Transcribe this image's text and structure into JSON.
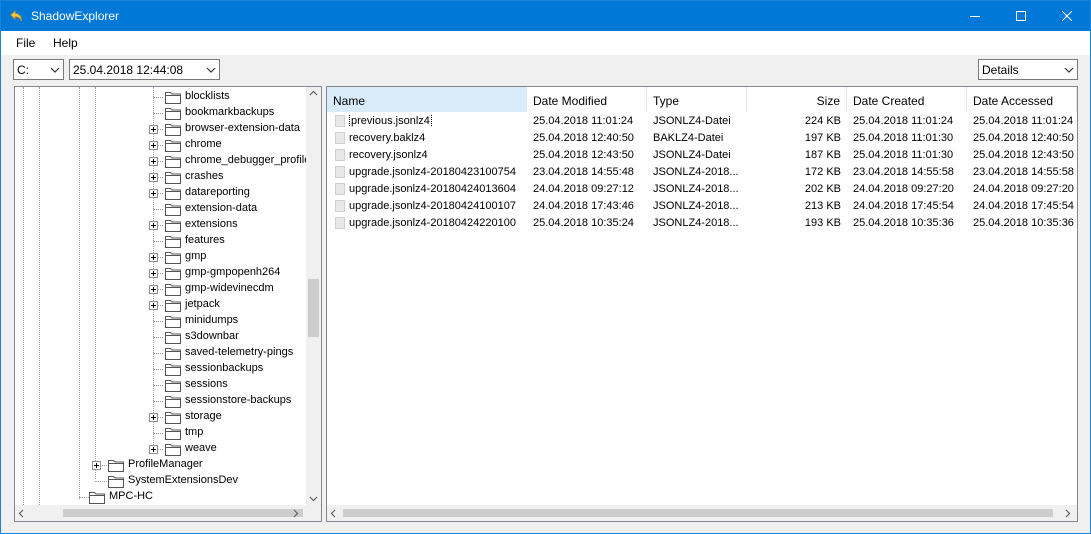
{
  "app": {
    "title": "ShadowExplorer"
  },
  "menu": {
    "file": "File",
    "help": "Help"
  },
  "toolbar": {
    "drive": "C:",
    "snapshot": "25.04.2018 12:44:08",
    "view": "Details"
  },
  "tree": {
    "items": [
      {
        "label": "blocklists",
        "expandable": false
      },
      {
        "label": "bookmarkbackups",
        "expandable": false
      },
      {
        "label": "browser-extension-data",
        "expandable": true
      },
      {
        "label": "chrome",
        "expandable": true
      },
      {
        "label": "chrome_debugger_profile",
        "expandable": true
      },
      {
        "label": "crashes",
        "expandable": true
      },
      {
        "label": "datareporting",
        "expandable": true
      },
      {
        "label": "extension-data",
        "expandable": false
      },
      {
        "label": "extensions",
        "expandable": true
      },
      {
        "label": "features",
        "expandable": false
      },
      {
        "label": "gmp",
        "expandable": true
      },
      {
        "label": "gmp-gmpopenh264",
        "expandable": true
      },
      {
        "label": "gmp-widevinecdm",
        "expandable": true
      },
      {
        "label": "jetpack",
        "expandable": true
      },
      {
        "label": "minidumps",
        "expandable": false
      },
      {
        "label": "s3downbar",
        "expandable": false
      },
      {
        "label": "saved-telemetry-pings",
        "expandable": false
      },
      {
        "label": "sessionbackups",
        "expandable": false
      },
      {
        "label": "sessions",
        "expandable": false
      },
      {
        "label": "sessionstore-backups",
        "expandable": false
      },
      {
        "label": "storage",
        "expandable": true
      },
      {
        "label": "tmp",
        "expandable": false
      },
      {
        "label": "weave",
        "expandable": true
      }
    ],
    "parent_items": [
      {
        "label": "ProfileManager",
        "expandable": true
      },
      {
        "label": "SystemExtensionsDev",
        "expandable": false
      }
    ],
    "root_items": [
      {
        "label": "MPC-HC",
        "expandable": false
      }
    ]
  },
  "list": {
    "columns": [
      "Name",
      "Date Modified",
      "Type",
      "Size",
      "Date Created",
      "Date Accessed"
    ],
    "rows": [
      [
        "previous.jsonlz4",
        "25.04.2018 11:01:24",
        "JSONLZ4-Datei",
        "224 KB",
        "25.04.2018 11:01:24",
        "25.04.2018 11:01:24"
      ],
      [
        "recovery.baklz4",
        "25.04.2018 12:40:50",
        "BAKLZ4-Datei",
        "197 KB",
        "25.04.2018 11:01:30",
        "25.04.2018 12:40:50"
      ],
      [
        "recovery.jsonlz4",
        "25.04.2018 12:43:50",
        "JSONLZ4-Datei",
        "187 KB",
        "25.04.2018 11:01:30",
        "25.04.2018 12:43:50"
      ],
      [
        "upgrade.jsonlz4-20180423100754",
        "23.04.2018 14:55:48",
        "JSONLZ4-2018...",
        "172 KB",
        "23.04.2018 14:55:58",
        "23.04.2018 14:55:58"
      ],
      [
        "upgrade.jsonlz4-20180424013604",
        "24.04.2018 09:27:12",
        "JSONLZ4-2018...",
        "202 KB",
        "24.04.2018 09:27:20",
        "24.04.2018 09:27:20"
      ],
      [
        "upgrade.jsonlz4-20180424100107",
        "24.04.2018 17:43:46",
        "JSONLZ4-2018...",
        "213 KB",
        "24.04.2018 17:45:54",
        "24.04.2018 17:45:54"
      ],
      [
        "upgrade.jsonlz4-20180424220100",
        "25.04.2018 10:35:24",
        "JSONLZ4-2018...",
        "193 KB",
        "25.04.2018 10:35:36",
        "25.04.2018 10:35:36"
      ]
    ]
  },
  "colors": {
    "titlebar": "#0078d7",
    "sorted_header": "#d9ebf9"
  }
}
